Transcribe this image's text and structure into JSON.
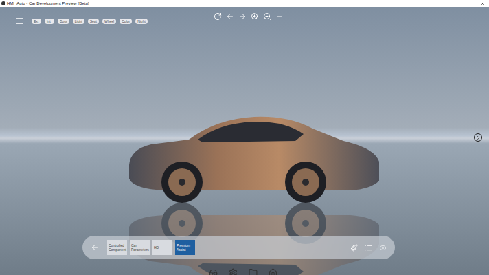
{
  "window": {
    "title": "HMI_Auto - Car Development Preview (Beta)"
  },
  "top_pills": [
    {
      "label": "Ext",
      "selected": false
    },
    {
      "label": "Int",
      "selected": false
    },
    {
      "label": "Door",
      "selected": false
    },
    {
      "label": "Light",
      "selected": false
    },
    {
      "label": "Seat",
      "selected": false
    },
    {
      "label": "Wheel",
      "selected": false
    },
    {
      "label": "Color",
      "selected": false
    },
    {
      "label": "Night",
      "selected": false
    }
  ],
  "toolbar": {
    "items": [
      {
        "label": "Controlled Component",
        "selected": false
      },
      {
        "label": "Car Parameters",
        "selected": false
      },
      {
        "label": "HD",
        "selected": false
      },
      {
        "label": "Premium Assist",
        "selected": true
      }
    ]
  }
}
